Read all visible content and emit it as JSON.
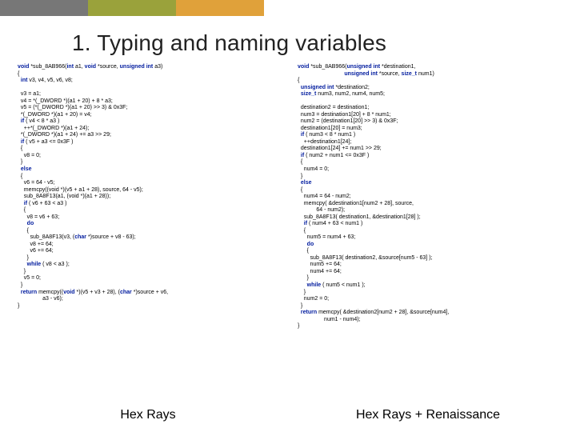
{
  "title": "1. Typing and naming variables",
  "captions": {
    "left": "Hex Rays",
    "right": "Hex Rays + Renaissance"
  },
  "kw": {
    "void": "void",
    "int": "int",
    "unsignedint": "unsigned int",
    "size_t": "size_t",
    "if": "if",
    "else": "else",
    "do": "do",
    "while": "while",
    "return": "return",
    "char": "char"
  },
  "left": {
    "sig_pre": " *sub_8AB966(",
    "sig_a1": " a1, ",
    "sig_src": " *source, ",
    "sig_a3": " a3)",
    "l_open": "{",
    "l_decl": " v3, v4, v5, v6, v8;",
    "l_blank1": "",
    "l_v3": "  v3 = a1;",
    "l_v4": "  v4 = *(_DWORD *)(a1 + 20) + 8 * a3;",
    "l_v5": "  v5 = (*(_DWORD *)(a1 + 20) >> 3) & 0x3F;",
    "l_s1": "  *(_DWORD *)(a1 + 20) = v4;",
    "l_if1a": " ( v4 < 8 * a3 )",
    "l_inc": "    ++*(_DWORD *)(a1 + 24);",
    "l_s2": "  *(_DWORD *)(a1 + 24) += a3 >> 29;",
    "l_if2a": " ( v5 + a3 <= 0x3F )",
    "l_bo1": "  {",
    "l_v8a": "    v8 = 0;",
    "l_bc1": "  }",
    "l_bo2": "  {",
    "l_v6": "    v6 = 64 - v5;",
    "l_memcpy1": "    memcpy((void *)(v5 + a1 + 28), source, 64 - v5);",
    "l_call1": "    sub_8A8F13(a1, (void *)(a1 + 28));",
    "l_if3a": " ( v6 + 63 < a3 )",
    "l_bo3": "    {",
    "l_v8b": "      v8 = v6 + 63;",
    "l_bo4": "      {",
    "l_call2": "        sub_8A8F13(v3, (",
    "l_call2b": " *)source + v8 - 63);",
    "l_v8c": "        v8 += 64;",
    "l_v6b": "        v6 += 64;",
    "l_bc4": "      }",
    "l_wh1": " ( v8 < a3 );",
    "l_bc3": "    }",
    "l_v5b": "    v5 = 0;",
    "l_bc2": "  }",
    "l_ret1": " memcpy((",
    "l_ret1b": " *)(v5 + v3 + 28), (",
    "l_ret1c": " *)source + v6,",
    "l_ret2": "                a3 - v6);",
    "l_close": "}"
  },
  "right": {
    "sig_pre": " *sub_8AB966(",
    "sig_d1": " *destination1,",
    "sig_line2a": "                              ",
    "sig_src": " *source, ",
    "sig_n1": " num1)",
    "r_open": "{",
    "r_decl_a": " *destination2;",
    "r_decl_b": " num3, num2, num4, num5;",
    "r_blank1": "",
    "r_d2": "  destination2 = destination1;",
    "r_n3": "  num3 = destination1[20] + 8 * num1;",
    "r_n2": "  num2 = (destination1[20] >> 3) & 0x3F;",
    "r_s1": "  destination1[20] = num3;",
    "r_if1a": " ( num3 < 8 * num1 )",
    "r_inc": "    ++destination1[24];",
    "r_s2": "  destination1[24] += num1 >> 29;",
    "r_if2a": " ( num2 + num1 <= 0x3F )",
    "r_bo1": "  {",
    "r_n4a": "    num4 = 0;",
    "r_bc1": "  }",
    "r_bo2": "  {",
    "r_n4b": "    num4 = 64 - num2;",
    "r_memcpy1a": "    memcpy( &destination1[num2 + 28], source,",
    "r_memcpy1b": "            64 - num2);",
    "r_call1": "    sub_8A8F13( destination1, &destination1[28] );",
    "r_if3a": " ( num4 + 63 < num1 )",
    "r_bo3": "    {",
    "r_n5a": "      num5 = num4 + 63;",
    "r_bo4": "      {",
    "r_call2": "        sub_8A8F13( destination2, &source[num5 - 63] );",
    "r_n5b": "        num5 += 64;",
    "r_n4c": "        num4 += 64;",
    "r_bc4": "      }",
    "r_wh1": " ( num5 < num1 );",
    "r_bc3": "    }",
    "r_n2b": "    num2 = 0;",
    "r_bc2": "  }",
    "r_ret1": " memcpy( &destination2[num2 + 28], &source[num4],",
    "r_ret2": "                 num1 - num4);",
    "r_close": "}"
  }
}
